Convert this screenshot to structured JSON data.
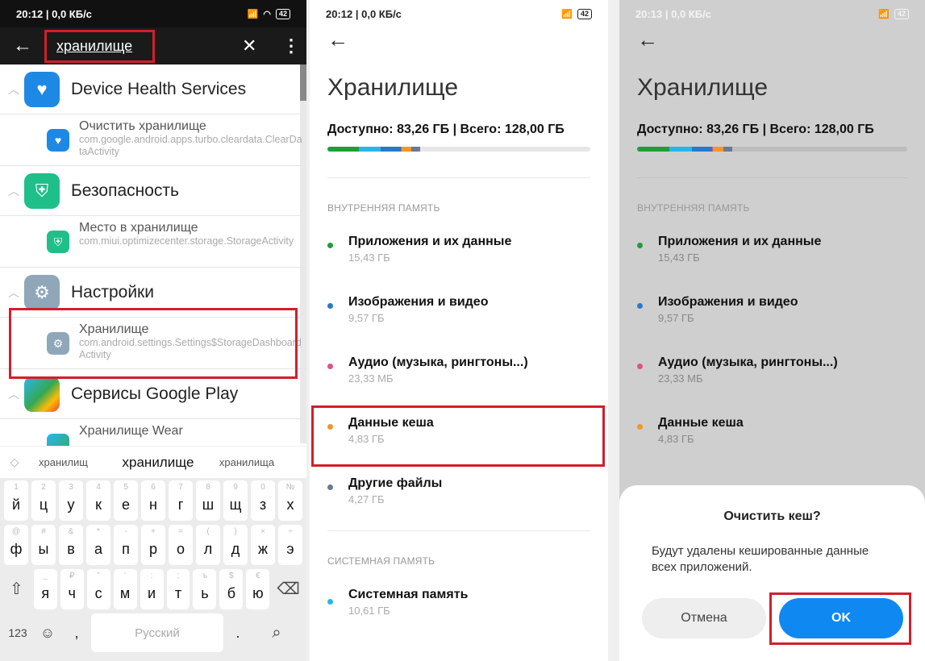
{
  "panel1": {
    "status": {
      "time_net": "20:12 | 0,0 КБ/с",
      "signal": "..ıl ..ıl",
      "battery": "42"
    },
    "search": {
      "value": "хранилище",
      "back_icon": "←",
      "clear_icon": "✕",
      "more_icon": "⋮"
    },
    "results": [
      {
        "group": "Device Health Services",
        "icon_color": "#1e88e5",
        "icon": "📱",
        "sub_title": "Очистить хранилище",
        "sub_desc": "com.google.android.apps.turbo.cleardata.ClearDataActivity"
      },
      {
        "group": "Безопасность",
        "icon_color": "#1fbf8a",
        "icon": "⚡",
        "sub_title": "Место в хранилище",
        "sub_desc": "com.miui.optimizecenter.storage.StorageActivity"
      },
      {
        "group": "Настройки",
        "icon_color": "#8fa7b8",
        "icon": "⚙",
        "sub_title": "Хранилище",
        "sub_desc": "com.android.settings.Settings$StorageDashboardActivity"
      },
      {
        "group": "Сервисы Google Play",
        "icon_color": "#34a853",
        "icon": "✚",
        "sub_title": "Хранилище Wear",
        "sub_desc": ""
      }
    ],
    "suggestions": [
      "хранилищ",
      "хранилище",
      "хранилища"
    ],
    "keyboard": {
      "row1": [
        [
          "1",
          "й"
        ],
        [
          "2",
          "ц"
        ],
        [
          "3",
          "у"
        ],
        [
          "4",
          "к"
        ],
        [
          "5",
          "е"
        ],
        [
          "6",
          "н"
        ],
        [
          "7",
          "г"
        ],
        [
          "8",
          "ш"
        ],
        [
          "9",
          "щ"
        ],
        [
          "0",
          "з"
        ],
        [
          "№",
          "х"
        ]
      ],
      "row2": [
        [
          "@",
          "ф"
        ],
        [
          "#",
          "ы"
        ],
        [
          "&",
          "в"
        ],
        [
          "*",
          "а"
        ],
        [
          "-",
          "п"
        ],
        [
          "+",
          "р"
        ],
        [
          "=",
          "о"
        ],
        [
          "(",
          "л"
        ],
        [
          ")",
          "д"
        ],
        [
          "×",
          "ж"
        ],
        [
          "÷",
          "э"
        ]
      ],
      "row3": [
        [
          "_",
          "я"
        ],
        [
          "₽",
          "ч"
        ],
        [
          "\"",
          "с"
        ],
        [
          "'",
          "м"
        ],
        [
          ":",
          "и"
        ],
        [
          ";",
          "т"
        ],
        [
          "ъ",
          "ь"
        ],
        [
          "$",
          "б"
        ],
        [
          "€",
          "ю"
        ]
      ],
      "shift": "⇧",
      "backspace": "⌫",
      "numbers": "123",
      "emoji": "☺",
      "comma": ",",
      "space": "Русский",
      "period": ".",
      "search": "🔍"
    }
  },
  "panel2": {
    "status": {
      "time_net": "20:12 | 0,0 КБ/с",
      "battery": "42"
    },
    "back_icon": "←",
    "title": "Хранилище",
    "available": "Доступно: 83,26 ГБ | Всего: 128,00 ГБ",
    "usage_segments": [
      {
        "name": "apps",
        "gb": 15.43,
        "color": "#1e9e3a"
      },
      {
        "name": "system",
        "gb": 10.61,
        "color": "#25b8e6"
      },
      {
        "name": "images",
        "gb": 9.57,
        "color": "#2b78c9"
      },
      {
        "name": "audio",
        "gb": 0.5,
        "color": "#e0508a"
      },
      {
        "name": "cache",
        "gb": 4.83,
        "color": "#f0962a"
      },
      {
        "name": "other",
        "gb": 4.27,
        "color": "#6b7a90"
      }
    ],
    "total_gb": 128,
    "section_internal": "ВНУТРЕННЯЯ ПАМЯТЬ",
    "items": [
      {
        "label": "Приложения и их данные",
        "size": "15,43 ГБ",
        "color": "#1e9e3a"
      },
      {
        "label": "Изображения и видео",
        "size": "9,57 ГБ",
        "color": "#2b78c9"
      },
      {
        "label": "Аудио (музыка, рингтоны...)",
        "size": "23,33 МБ",
        "color": "#e0508a"
      },
      {
        "label": "Данные кеша",
        "size": "4,83 ГБ",
        "color": "#f0962a"
      },
      {
        "label": "Другие файлы",
        "size": "4,27 ГБ",
        "color": "#6b7a90"
      }
    ],
    "section_system": "СИСТЕМНАЯ ПАМЯТЬ",
    "system_item": {
      "label": "Системная память",
      "size": "10,61 ГБ",
      "color": "#25b8e6"
    }
  },
  "panel3": {
    "status": {
      "time_net": "20:13 | 0,0 КБ/с",
      "battery": "42"
    },
    "dialog": {
      "title": "Очистить кеш?",
      "message": "Будут удалены кешированные данные всех приложений.",
      "cancel": "Отмена",
      "ok": "OK"
    }
  }
}
